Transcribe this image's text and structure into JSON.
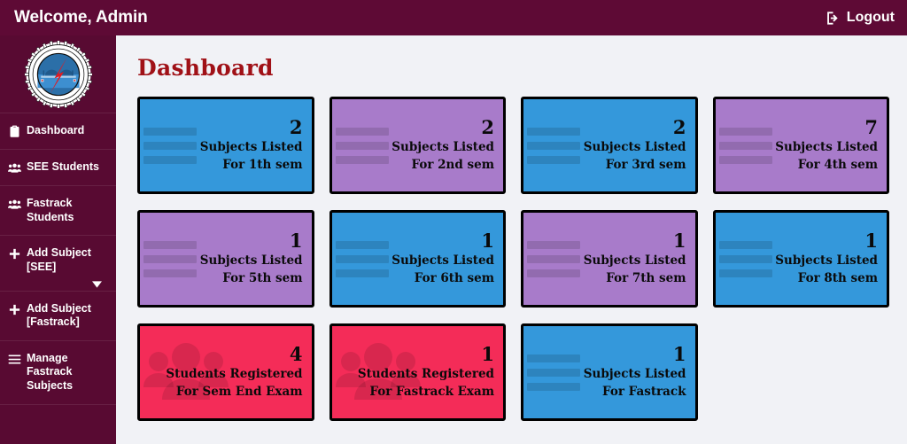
{
  "header": {
    "welcome": "Welcome, Admin",
    "logout_label": "Logout",
    "logout_icon": "sign-out-icon",
    "background_color": "#5e0a35"
  },
  "sidebar": {
    "background_color": "#580a32",
    "logo_alt": "college-emblem-logo",
    "items": [
      {
        "label": "Dashboard",
        "icon": "clipboard-icon",
        "has_caret": false
      },
      {
        "label": "SEE Students",
        "icon": "users-icon",
        "has_caret": false
      },
      {
        "label": "Fastrack Students",
        "icon": "users-icon",
        "has_caret": false
      },
      {
        "label": "Add Subject [SEE]",
        "icon": "plus-icon",
        "has_caret": true
      },
      {
        "label": "Add Subject [Fastrack]",
        "icon": "plus-icon",
        "has_caret": false
      },
      {
        "label": "Manage Fastrack Subjects",
        "icon": "hamburger-icon",
        "has_caret": false
      }
    ]
  },
  "main": {
    "page_title": "Dashboard",
    "title_color": "#a01117",
    "background_color": "#f1f2f6",
    "cards": [
      {
        "value": "2",
        "line1": "Subjects Listed",
        "line2": "For 1th sem",
        "color": "blue",
        "icon": "list-lines-icon"
      },
      {
        "value": "2",
        "line1": "Subjects Listed",
        "line2": "For 2nd sem",
        "color": "purple",
        "icon": "list-lines-icon"
      },
      {
        "value": "2",
        "line1": "Subjects Listed",
        "line2": "For 3rd sem",
        "color": "blue",
        "icon": "list-lines-icon"
      },
      {
        "value": "7",
        "line1": "Subjects Listed",
        "line2": "For 4th sem",
        "color": "purple",
        "icon": "list-lines-icon"
      },
      {
        "value": "1",
        "line1": "Subjects Listed",
        "line2": "For 5th sem",
        "color": "purple",
        "icon": "list-lines-icon"
      },
      {
        "value": "1",
        "line1": "Subjects Listed",
        "line2": "For 6th sem",
        "color": "blue",
        "icon": "list-lines-icon"
      },
      {
        "value": "1",
        "line1": "Subjects Listed",
        "line2": "For 7th sem",
        "color": "purple",
        "icon": "list-lines-icon"
      },
      {
        "value": "1",
        "line1": "Subjects Listed",
        "line2": "For 8th sem",
        "color": "blue",
        "icon": "list-lines-icon"
      },
      {
        "value": "4",
        "line1": "Students Registered",
        "line2": "For Sem End Exam",
        "color": "red",
        "icon": "users-group-icon"
      },
      {
        "value": "1",
        "line1": "Students Registered",
        "line2": "For Fastrack Exam",
        "color": "red",
        "icon": "users-group-icon"
      },
      {
        "value": "1",
        "line1": "Subjects Listed",
        "line2": "For Fastrack",
        "color": "blue",
        "icon": "list-lines-icon"
      }
    ]
  },
  "palette": {
    "blue": "#3498db",
    "purple": "#a87bca",
    "red": "#f42c58",
    "maroon": "#5e0a35",
    "card_border": "#000000"
  }
}
